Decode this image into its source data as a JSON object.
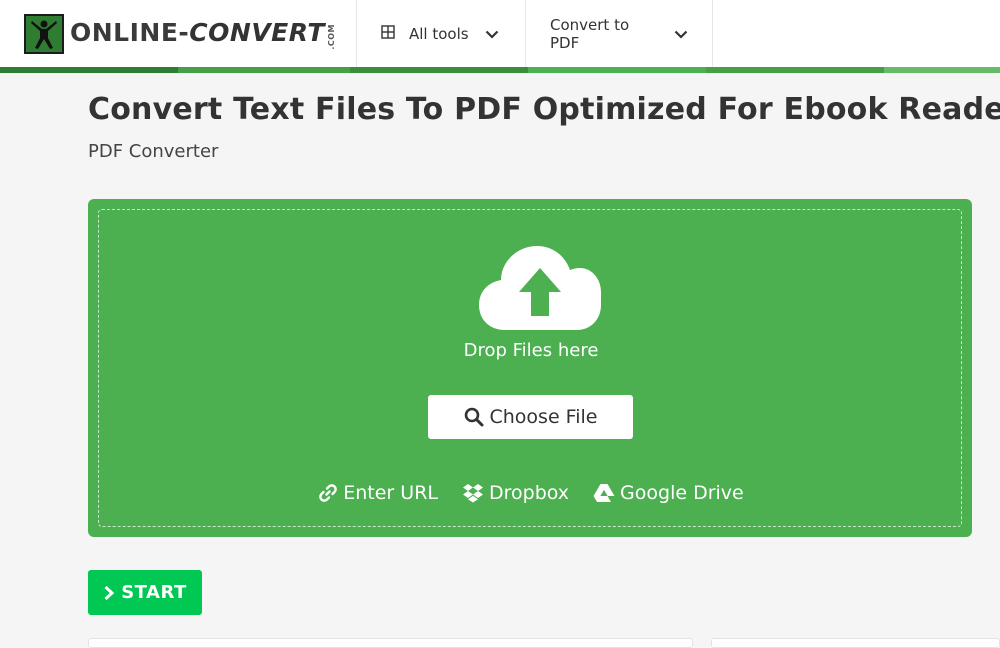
{
  "header": {
    "logo": {
      "main": "ONLINE-",
      "accent": "CONVERT",
      "com": ".COM"
    },
    "nav": [
      {
        "label": "All tools"
      },
      {
        "label": "Convert to PDF"
      }
    ]
  },
  "page": {
    "title": "Convert Text Files To PDF Optimized For Ebook Reader",
    "subtitle": "PDF Converter"
  },
  "upload": {
    "drop_label": "Drop Files here",
    "choose_label": "Choose File",
    "sources": [
      {
        "label": "Enter URL",
        "icon": "link-icon"
      },
      {
        "label": "Dropbox",
        "icon": "dropbox-icon"
      },
      {
        "label": "Google Drive",
        "icon": "google-drive-icon"
      }
    ]
  },
  "actions": {
    "start_label": "START"
  },
  "colors": {
    "dropzone": "#4caf50",
    "start": "#00c853",
    "stripe": [
      "#2e7d32",
      "#43a047",
      "#4caf50",
      "#66bb6a"
    ]
  }
}
